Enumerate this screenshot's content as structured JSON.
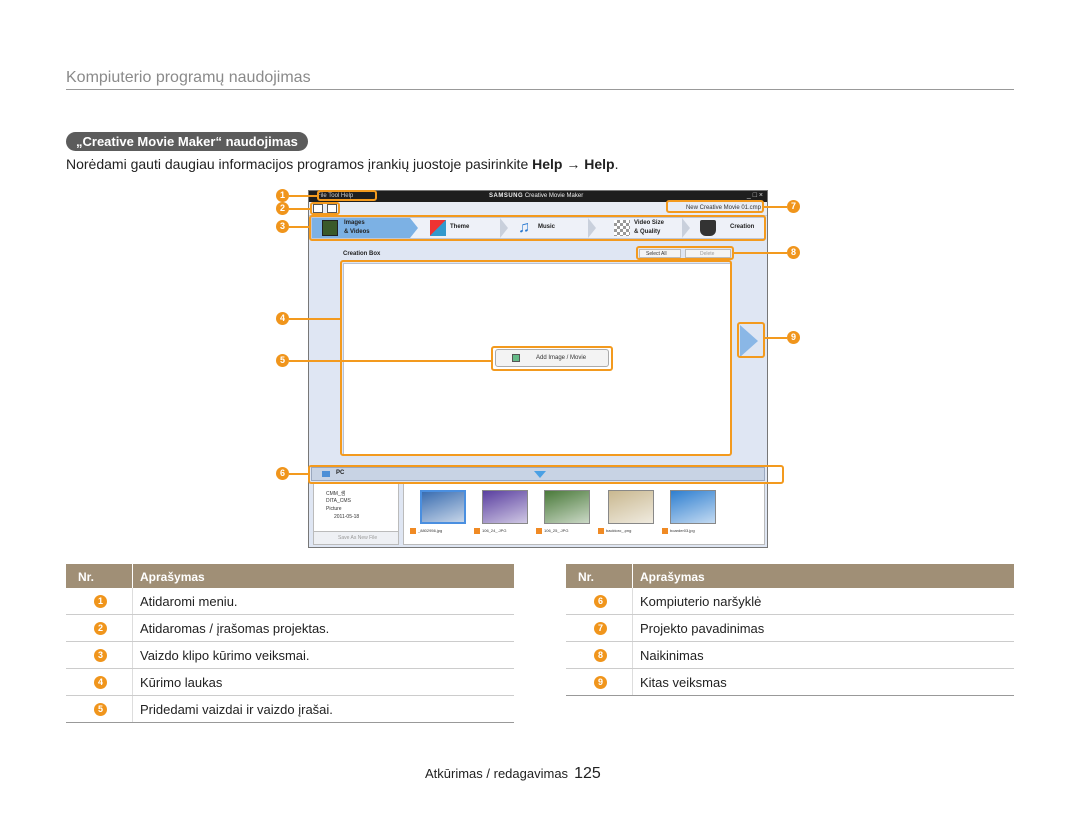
{
  "page": {
    "title": "Kompiuterio programų naudojimas",
    "section": "„Creative Movie Maker“ naudojimas",
    "intro_text": "Norėdami gauti daugiau informacijos programos įrankių juostoje pasirinkite ",
    "intro_help1": "Help",
    "intro_arrow": " → ",
    "intro_help2": "Help",
    "intro_end": "."
  },
  "app": {
    "menu": "File  Tool  Help",
    "brand_logo": "SAMSUNG",
    "brand_name": "Creative Movie Maker",
    "window_buttons": "_ □ ×",
    "project_name": "New Creative Movie 01.cmp",
    "steps": [
      {
        "line1": "Images",
        "line2": "& Videos",
        "icon": "film-icon"
      },
      {
        "line1": "Theme",
        "line2": "",
        "icon": "theme-icon"
      },
      {
        "line1": "Music",
        "line2": "",
        "icon": "music-icon"
      },
      {
        "line1": "Video Size",
        "line2": "& Quality",
        "icon": "checker-icon"
      },
      {
        "line1": "Creation",
        "line2": "",
        "icon": "hat-icon"
      }
    ],
    "creation_box_label": "Creation Box",
    "select_all": "Select All",
    "delete": "Delete",
    "add_button": "Add Image / Movie",
    "pc_label": "PC",
    "tree": [
      "CMM_샘",
      "DITA_CMS",
      "Picture",
      "2011-05-18"
    ],
    "save_as": "Save As New File",
    "thumbs": [
      {
        "caption": "_8802956.jpg",
        "color": "#3a6db0"
      },
      {
        "caption": "106_24_.JPG",
        "color": "#5a3fa0"
      },
      {
        "caption": "106_25_.JPG",
        "color": "#4a7a3a"
      },
      {
        "caption": "backtoro_.png",
        "color": "#c9b890"
      },
      {
        "caption": "boarder03.jpg",
        "color": "#2f7fd0"
      }
    ]
  },
  "callouts": [
    "1",
    "2",
    "3",
    "4",
    "5",
    "6",
    "7",
    "8",
    "9"
  ],
  "table_headers": {
    "nr": "Nr.",
    "desc": "Aprašymas"
  },
  "table_left": [
    {
      "nr": "1",
      "desc": "Atidaromi meniu."
    },
    {
      "nr": "2",
      "desc": "Atidaromas / įrašomas projektas."
    },
    {
      "nr": "3",
      "desc": "Vaizdo klipo kūrimo veiksmai."
    },
    {
      "nr": "4",
      "desc": "Kūrimo laukas"
    },
    {
      "nr": "5",
      "desc": "Pridedami vaizdai ir vaizdo įrašai."
    }
  ],
  "table_right": [
    {
      "nr": "6",
      "desc": "Kompiuterio naršyklė"
    },
    {
      "nr": "7",
      "desc": "Projekto pavadinimas"
    },
    {
      "nr": "8",
      "desc": "Naikinimas"
    },
    {
      "nr": "9",
      "desc": "Kitas veiksmas"
    }
  ],
  "footer": {
    "text": "Atkūrimas / redagavimas",
    "page_number": "125"
  },
  "colors": {
    "accent": "#f0951c",
    "table_header": "#a08f76",
    "pill": "#5c5c5c"
  }
}
